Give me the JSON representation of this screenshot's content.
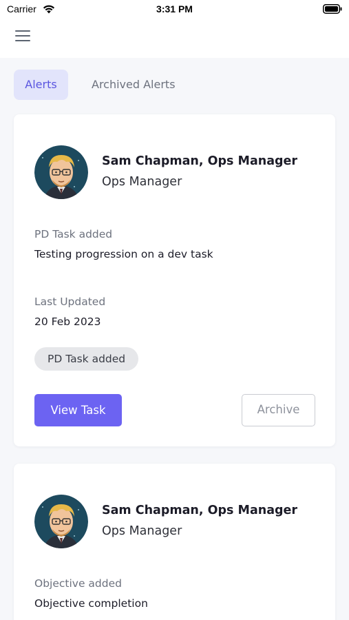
{
  "status_bar": {
    "carrier": "Carrier",
    "time": "3:31 PM",
    "wifi_icon": "wifi-icon",
    "battery_icon": "battery-icon"
  },
  "header": {
    "menu_icon": "hamburger-menu-icon"
  },
  "tabs": [
    {
      "label": "Alerts",
      "active": true
    },
    {
      "label": "Archived Alerts",
      "active": false
    }
  ],
  "alerts": [
    {
      "user_name": "Sam Chapman, Ops Manager",
      "user_role": "Ops Manager",
      "type_label": "PD Task added",
      "title": "Testing progression on a dev task",
      "updated_label": "Last Updated",
      "updated_value": "20 Feb 2023",
      "tag": "PD Task added",
      "primary_action": "View Task",
      "secondary_action": "Archive"
    },
    {
      "user_name": "Sam Chapman, Ops Manager",
      "user_role": "Ops Manager",
      "type_label": "Objective added",
      "title": "Objective completion"
    }
  ],
  "colors": {
    "accent": "#6c63f2",
    "tab_active_bg": "#e2e4fb",
    "tab_active_text": "#5a55e0",
    "background": "#f6f7fa",
    "tag_bg": "#e6e7ea"
  }
}
